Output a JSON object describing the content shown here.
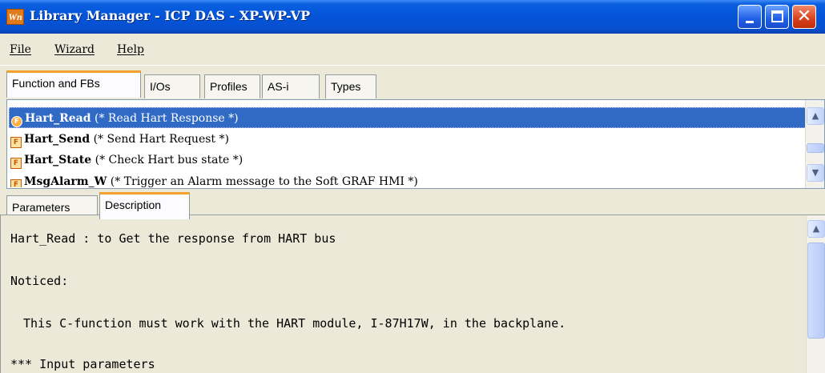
{
  "window": {
    "title": "Library Manager - ICP DAS - XP-WP-VP",
    "icon_text": "Wn",
    "close_glyph": "✕"
  },
  "menu": {
    "items": [
      {
        "label": "File"
      },
      {
        "label": "Wizard"
      },
      {
        "label": "Help"
      }
    ]
  },
  "top_tabs": [
    {
      "label": "Function and FBs",
      "active": true
    },
    {
      "label": "I/Os"
    },
    {
      "label": "Profiles"
    },
    {
      "label": "AS-i"
    },
    {
      "label": "Types"
    }
  ],
  "function_list": {
    "icon_letter": "F",
    "rows": [
      {
        "name": "Hart_Read",
        "comment": "(* Read Hart Response *)",
        "selected": true
      },
      {
        "name": "Hart_Send",
        "comment": "(* Send Hart Request *)"
      },
      {
        "name": "Hart_State",
        "comment": "(* Check Hart bus state *)"
      },
      {
        "name": "MsgAlarm_W",
        "comment": "(* Trigger an Alarm message to the Soft GRAF HMI *)"
      }
    ]
  },
  "scroll_arrows": {
    "up": "▲",
    "down": "▼"
  },
  "bottom_tabs": [
    {
      "label": "Parameters"
    },
    {
      "label": "Description",
      "active": true
    }
  ],
  "description": {
    "lines": [
      "Hart_Read : to Get the response from HART bus",
      "Noticed:",
      "This C-function must work with the HART module, I-87H17W, in the backplane.",
      "*** Input parameters"
    ]
  },
  "colors": {
    "selection": "#316ac5",
    "titlebar": "#0554d8",
    "active_tab_accent": "#f2a12c"
  }
}
